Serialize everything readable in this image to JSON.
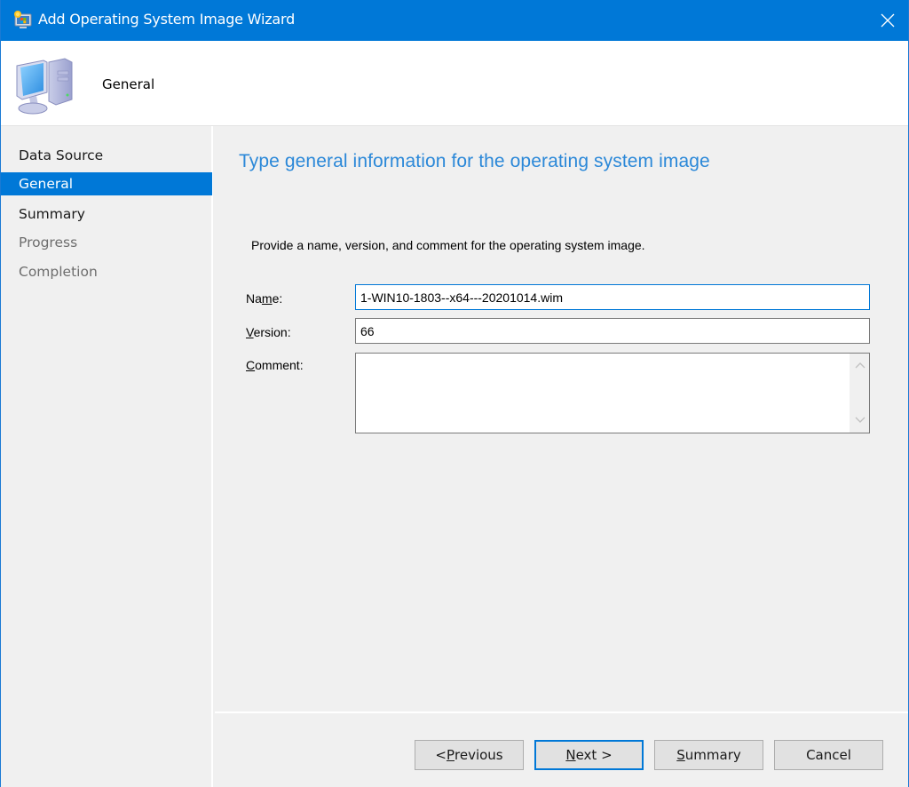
{
  "window": {
    "title": "Add Operating System Image Wizard",
    "app_icon": "computer-wizard-icon",
    "close_icon": "close-icon",
    "accent_color": "#0078d7"
  },
  "header": {
    "icon": "computer-icon",
    "title": "General"
  },
  "nav": {
    "items": [
      {
        "label": "Data Source",
        "state": "normal"
      },
      {
        "label": "General",
        "state": "active"
      },
      {
        "label": "Summary",
        "state": "normal"
      },
      {
        "label": "Progress",
        "state": "disabled"
      },
      {
        "label": "Completion",
        "state": "disabled"
      }
    ]
  },
  "page": {
    "heading": "Type general information for the operating system image",
    "instruction": "Provide a name, version, and comment for the operating system image.",
    "heading_color": "#2b88d8",
    "fields": {
      "name": {
        "label_pre": "Na",
        "label_accel": "m",
        "label_post": "e:",
        "value": "1-WIN10-1803--x64---20201014.wim"
      },
      "version": {
        "label_pre": "",
        "label_accel": "V",
        "label_post": "ersion:",
        "value": "66"
      },
      "comment": {
        "label_pre": "",
        "label_accel": "C",
        "label_post": "omment:",
        "value": ""
      }
    }
  },
  "footer": {
    "buttons": {
      "previous": {
        "pre": "< ",
        "accel": "P",
        "post": "revious"
      },
      "next": {
        "pre": "",
        "accel": "N",
        "post": "ext >"
      },
      "summary": {
        "pre": "",
        "accel": "S",
        "post": "ummary"
      },
      "cancel": {
        "pre": "",
        "accel": "",
        "post": "Cancel"
      }
    }
  }
}
